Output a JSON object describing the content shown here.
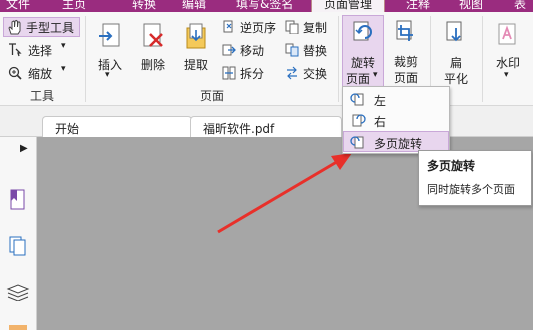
{
  "ribbon_tabs": [
    "文件",
    "主页",
    "转换",
    "编辑",
    "填写&签名",
    "页面管理",
    "注释",
    "视图",
    "表单"
  ],
  "tools_group": {
    "label": "工具",
    "hand": "手型工具",
    "select": "选择",
    "zoom": "缩放"
  },
  "pages_group": {
    "label": "页面",
    "insert": "插入",
    "delete": "删除",
    "extract": "提取",
    "reverse": "逆页序",
    "copy": "复制",
    "move": "移动",
    "replace": "替换",
    "split": "拆分",
    "swap": "交换"
  },
  "rotate": {
    "line1": "旋转",
    "line2": "页面"
  },
  "crop": {
    "line1": "裁剪",
    "line2": "页面"
  },
  "flatten": {
    "line1": "扁",
    "line2": "平化"
  },
  "watermark": "水印",
  "doc_tabs": {
    "start": "开始",
    "file": "福昕软件.pdf"
  },
  "rotate_menu": {
    "left": "左",
    "right": "右",
    "multi": "多页旋转"
  },
  "tooltip": {
    "title": "多页旋转",
    "desc": "同时旋转多个页面"
  },
  "colors": {
    "accent": "#9a2c7f",
    "highlight": "#e8d6ee",
    "arrow": "#e8302a"
  }
}
